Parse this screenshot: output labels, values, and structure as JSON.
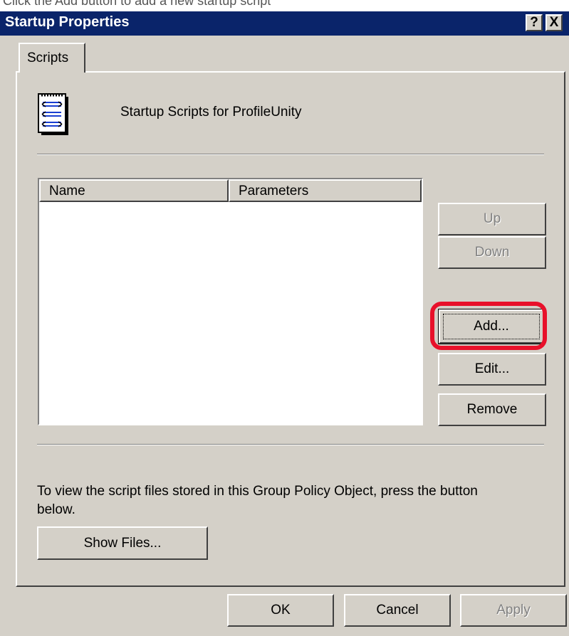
{
  "caption": "Click the Add button to add a new startup script",
  "window": {
    "title": "Startup Properties",
    "help_label": "?",
    "close_label": "X"
  },
  "tabs": [
    {
      "label": "Scripts",
      "active": true
    }
  ],
  "header": {
    "text": "Startup Scripts for ProfileUnity",
    "icon": "script-file-icon"
  },
  "scripts_list": {
    "columns": [
      "Name",
      "Parameters"
    ],
    "rows": []
  },
  "side_buttons": {
    "up": {
      "label": "Up",
      "enabled": false
    },
    "down": {
      "label": "Down",
      "enabled": false
    },
    "add": {
      "label": "Add...",
      "enabled": true,
      "highlighted": true
    },
    "edit": {
      "label": "Edit...",
      "enabled": true
    },
    "remove": {
      "label": "Remove",
      "enabled": true
    }
  },
  "info_text": "To view the script files stored in this Group Policy Object, press the button below.",
  "show_files_label": "Show Files...",
  "footer": {
    "ok": "OK",
    "cancel": "Cancel",
    "apply": "Apply",
    "apply_enabled": false
  },
  "colors": {
    "titlebar": "#0a246a",
    "dialog": "#d4d0c8",
    "highlight": "#e8102a"
  }
}
